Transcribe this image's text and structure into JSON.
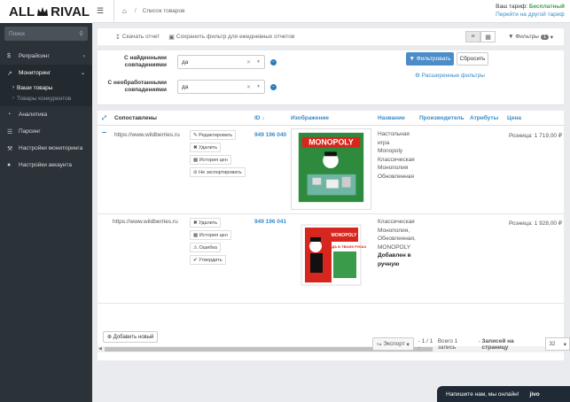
{
  "brand": {
    "logo_left": "ALL",
    "logo_right": "RIVAL"
  },
  "sidebar": {
    "search_placeholder": "Поиск",
    "items": [
      {
        "label": "Репрайсинг",
        "icon": "dollar-icon"
      },
      {
        "label": "Мониторинг",
        "icon": "chart-line-icon"
      },
      {
        "label": "Аналитика",
        "icon": "pie-chart-icon"
      },
      {
        "label": "Парсинг",
        "icon": "database-icon"
      },
      {
        "label": "Настройки мониторинга",
        "icon": "wrench-icon"
      },
      {
        "label": "Настройки аккаунта",
        "icon": "user-icon"
      }
    ],
    "sub": [
      {
        "label": "Ваши товары"
      },
      {
        "label": "Товары конкурентов"
      }
    ]
  },
  "topbar": {
    "breadcrumb": "Список товаров",
    "tariff_label": "Ваш тариф:",
    "tariff_value": "Бесплатный",
    "tariff_link": "Перейти на другой тариф"
  },
  "toolbar": {
    "download": "Скачать отчет",
    "save_filter": "Сохранить фильтр для ежедневных отчетов",
    "filters": "Фильтры",
    "filters_count": "1"
  },
  "filters": {
    "f1_label_1": "С найденными",
    "f1_label_2": "совпадениями",
    "f1_value": "да",
    "f2_label_1": "С необработанными",
    "f2_label_2": "совпадениями",
    "f2_value": "да",
    "apply": "Фильтровать",
    "reset": "Сбросить",
    "advanced": "Расширенные фильтры"
  },
  "table": {
    "headers": {
      "matched": "Сопоставлены",
      "id": "ID",
      "image": "Изображение",
      "name": "Название",
      "manufacturer": "Производитель",
      "attributes": "Атрибуты",
      "price": "Цена"
    },
    "rows": [
      {
        "source": "https://www.wildberries.ru",
        "actions": [
          "Редактировать",
          "Удалить",
          "История цен",
          "Не экспортировать"
        ],
        "id": "949 196 040",
        "name_lines": [
          "Настольная",
          "игра",
          "Monopoly",
          "Классическая",
          "Монополия",
          "Обновленная"
        ],
        "price": "Розница: 1 719,00 ₽",
        "image_title": "MONOPOLY"
      },
      {
        "source": "https://www.wildberries.ru",
        "actions": [
          "Удалить",
          "История цен",
          "Ошибка",
          "Утвердить"
        ],
        "id": "949 196 041",
        "name_lines": [
          "Классическая",
          "Монополия,",
          "Обновленная,",
          "MONOPOLY"
        ],
        "name_bold": [
          "Добавлен в",
          "ручную"
        ],
        "price": "Розница: 1 928,00 ₽",
        "image_title": "MONOPOLY",
        "image_sub": "ПОБЕДА В ТВОИХ РУКАХ"
      }
    ],
    "add_new": "Добавить новый"
  },
  "pager": {
    "export": "Экспорт",
    "pages": "- 1 / 1 -",
    "total": "Всего 1 запись",
    "per_page_label": "Записей на страницу",
    "per_page": "32"
  },
  "chat": {
    "text": "Напишите нам, мы онлайн!",
    "brand": "jivo"
  }
}
